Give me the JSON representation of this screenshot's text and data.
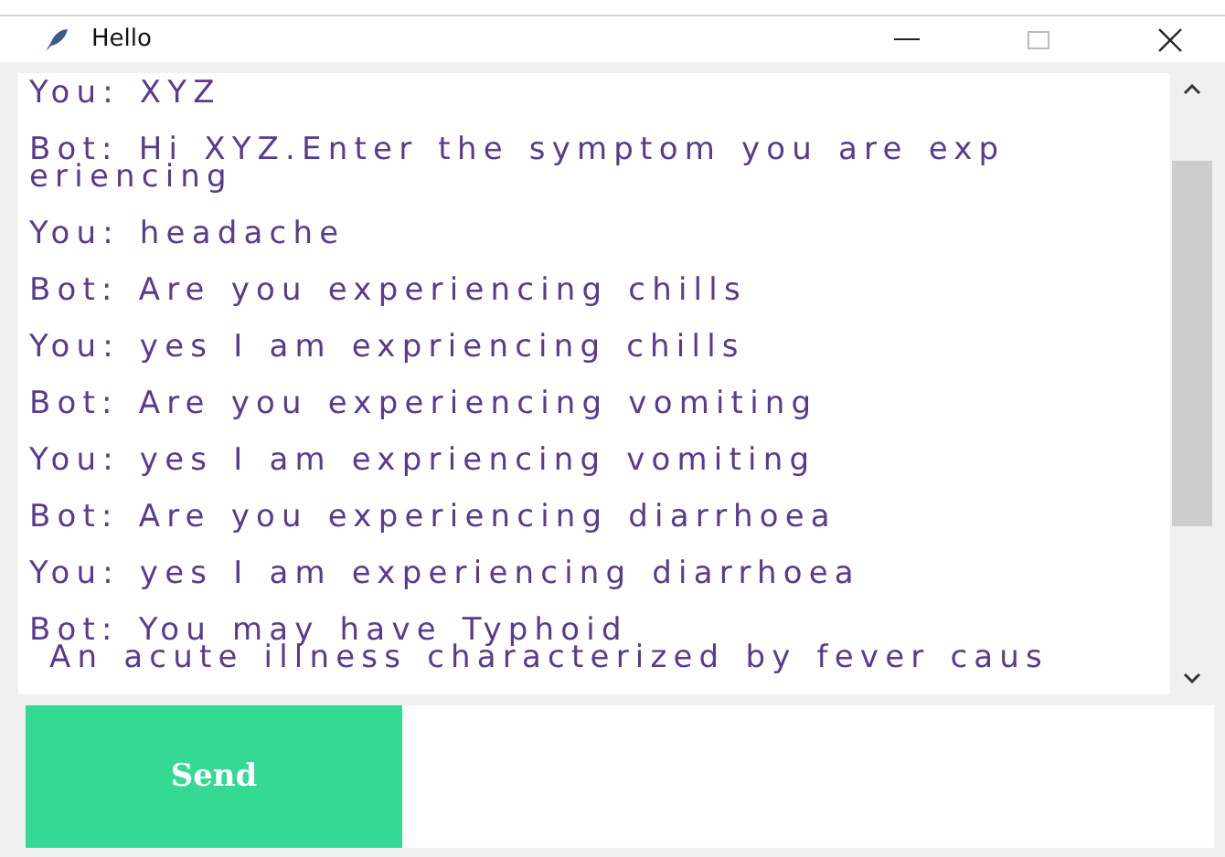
{
  "window": {
    "title": "Hello"
  },
  "messages": [
    {
      "lines": [
        "You: XYZ"
      ]
    },
    {
      "lines": [
        "Bot: Hi XYZ.Enter the symptom you are exp",
        "eriencing"
      ]
    },
    {
      "lines": [
        "You: headache"
      ]
    },
    {
      "lines": [
        "Bot: Are you experiencing chills"
      ]
    },
    {
      "lines": [
        "You: yes I am expriencing chills"
      ]
    },
    {
      "lines": [
        "Bot: Are you experiencing vomiting"
      ]
    },
    {
      "lines": [
        "You: yes I am expriencing vomiting"
      ]
    },
    {
      "lines": [
        "Bot: Are you experiencing diarrhoea"
      ]
    },
    {
      "lines": [
        "You: yes I am experiencing diarrhoea"
      ]
    },
    {
      "lines": [
        "Bot: You may have Typhoid",
        " An acute illness characterized by fever caus"
      ]
    }
  ],
  "send_button": {
    "label": "Send"
  }
}
